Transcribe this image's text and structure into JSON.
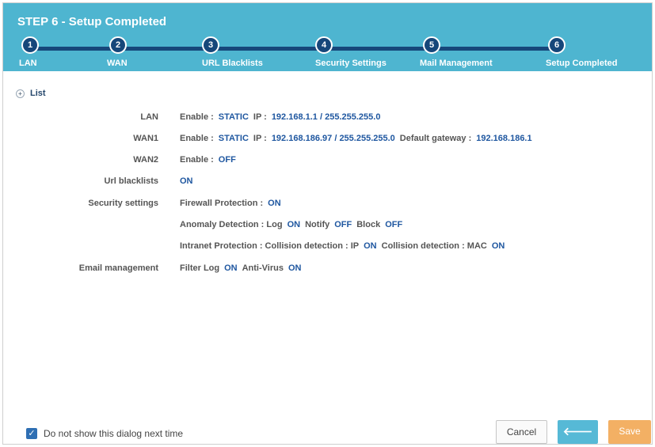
{
  "header": {
    "title": "STEP 6 - Setup Completed",
    "steps": [
      {
        "num": "1",
        "label": "LAN"
      },
      {
        "num": "2",
        "label": "WAN"
      },
      {
        "num": "3",
        "label": "URL Blacklists"
      },
      {
        "num": "4",
        "label": "Security Settings"
      },
      {
        "num": "5",
        "label": "Mail Management"
      },
      {
        "num": "6",
        "label": "Setup Completed"
      }
    ]
  },
  "list_toggle": {
    "icon": "plus-circle-icon",
    "label": "List"
  },
  "summary": {
    "lan": {
      "label": "LAN",
      "enable_label": "Enable :",
      "enable_value": "STATIC",
      "ip_label": "IP :",
      "ip_value": "192.168.1.1 / 255.255.255.0"
    },
    "wan1": {
      "label": "WAN1",
      "enable_label": "Enable :",
      "enable_value": "STATIC",
      "ip_label": "IP :",
      "ip_value": "192.168.186.97 / 255.255.255.0",
      "gw_label": "Default gateway :",
      "gw_value": "192.168.186.1"
    },
    "wan2": {
      "label": "WAN2",
      "enable_label": "Enable :",
      "enable_value": "OFF"
    },
    "url": {
      "label": "Url blacklists",
      "value": "ON"
    },
    "security": {
      "label": "Security settings",
      "firewall_label": "Firewall Protection :",
      "firewall_value": "ON",
      "anomaly_label": "Anomaly Detection : Log",
      "anomaly_log": "ON",
      "notify_label": "Notify",
      "notify_value": "OFF",
      "block_label": "Block",
      "block_value": "OFF",
      "intranet_label": "Intranet Protection : Collision detection : IP",
      "intranet_ip": "ON",
      "mac_label": "Collision detection : MAC",
      "mac_value": "ON"
    },
    "email": {
      "label": "Email management",
      "filter_label": "Filter Log",
      "filter_value": "ON",
      "av_label": "Anti-Virus",
      "av_value": "ON"
    }
  },
  "footer": {
    "checkbox_label": "Do not show this dialog next time",
    "checkbox_checked": true,
    "cancel_label": "Cancel",
    "back_icon": "arrow-left-icon",
    "back_glyph": "🡐",
    "save_label": "Save"
  },
  "colors": {
    "header": "#4eb5d0",
    "step": "#16477a",
    "value": "#1f57a0",
    "back": "#56b9d6",
    "save": "#f3b064"
  }
}
